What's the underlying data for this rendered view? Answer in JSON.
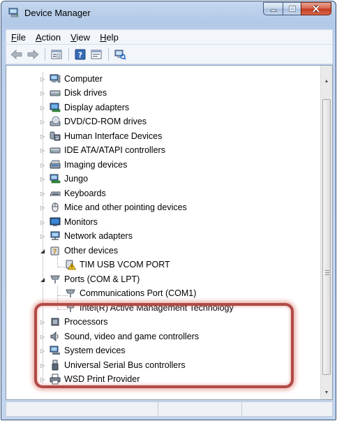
{
  "window": {
    "title": "Device Manager"
  },
  "menubar": {
    "items": [
      {
        "label": "File",
        "accel": "F",
        "rest": "ile"
      },
      {
        "label": "Action",
        "accel": "A",
        "rest": "ction"
      },
      {
        "label": "View",
        "accel": "V",
        "rest": "iew"
      },
      {
        "label": "Help",
        "accel": "H",
        "rest": "elp"
      }
    ]
  },
  "toolbar": {
    "buttons": [
      "back-arrow-icon",
      "forward-arrow-icon",
      "properties-icon",
      "help-icon",
      "show-hidden-icon",
      "scan-hardware-icon"
    ]
  },
  "tree": {
    "items": [
      {
        "label": "Computer",
        "icon": "computer-icon"
      },
      {
        "label": "Disk drives",
        "icon": "disk-drive-icon"
      },
      {
        "label": "Display adapters",
        "icon": "display-adapter-icon"
      },
      {
        "label": "DVD/CD-ROM drives",
        "icon": "dvd-drive-icon"
      },
      {
        "label": "Human Interface Devices",
        "icon": "hid-icon"
      },
      {
        "label": "IDE ATA/ATAPI controllers",
        "icon": "ide-controller-icon"
      },
      {
        "label": "Imaging devices",
        "icon": "imaging-device-icon"
      },
      {
        "label": "Jungo",
        "icon": "jungo-icon"
      },
      {
        "label": "Keyboards",
        "icon": "keyboard-icon"
      },
      {
        "label": "Mice and other pointing devices",
        "icon": "mouse-icon"
      },
      {
        "label": "Monitors",
        "icon": "monitor-icon"
      },
      {
        "label": "Network adapters",
        "icon": "network-adapter-icon"
      },
      {
        "label": "Other devices",
        "icon": "unknown-device-icon",
        "expanded": true
      },
      {
        "label": "TIM USB VCOM PORT",
        "icon": "warning-device-icon",
        "child": true
      },
      {
        "label": "Ports (COM & LPT)",
        "icon": "port-icon",
        "expanded": true
      },
      {
        "label": "Communications Port (COM1)",
        "icon": "port-icon",
        "child": true
      },
      {
        "label": "Intel(R) Active Management Technology",
        "icon": "port-icon",
        "child": true
      },
      {
        "label": "Processors",
        "icon": "processor-icon"
      },
      {
        "label": "Sound, video and game controllers",
        "icon": "sound-icon"
      },
      {
        "label": "System devices",
        "icon": "system-device-icon"
      },
      {
        "label": "Universal Serial Bus controllers",
        "icon": "usb-icon"
      },
      {
        "label": "WSD Print Provider",
        "icon": "printer-icon"
      }
    ]
  },
  "colors": {
    "highlight_border": "#b04a47",
    "window_frame": "#b9cde9",
    "close_button": "#c94a30"
  }
}
